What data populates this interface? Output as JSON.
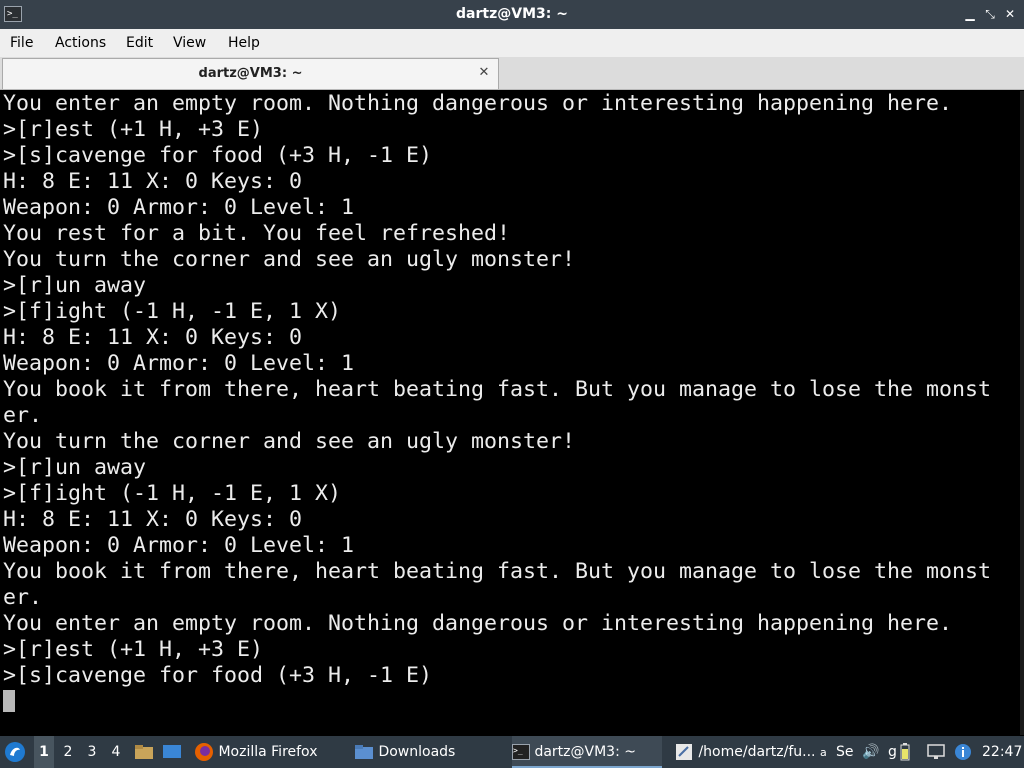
{
  "window": {
    "title": "dartz@VM3: ~",
    "buttons": {
      "minimize": "▁",
      "maximize": "⤡",
      "close": "✕"
    }
  },
  "menu": [
    "File",
    "Actions",
    "Edit",
    "View",
    "Help"
  ],
  "tab": {
    "label": "dartz@VM3: ~",
    "close": "✕"
  },
  "terminal": {
    "lines": [
      "You enter an empty room. Nothing dangerous or interesting happening here.",
      ">[r]est (+1 H, +3 E)",
      ">[s]cavenge for food (+3 H, -1 E)",
      "H: 8 E: 11 X: 0 Keys: 0",
      "Weapon: 0 Armor: 0 Level: 1",
      "You rest for a bit. You feel refreshed!",
      "You turn the corner and see an ugly monster!",
      ">[r]un away",
      ">[f]ight (-1 H, -1 E, 1 X)",
      "H: 8 E: 11 X: 0 Keys: 0",
      "Weapon: 0 Armor: 0 Level: 1",
      "You book it from there, heart beating fast. But you manage to lose the monst",
      "er.",
      "You turn the corner and see an ugly monster!",
      ">[r]un away",
      ">[f]ight (-1 H, -1 E, 1 X)",
      "H: 8 E: 11 X: 0 Keys: 0",
      "Weapon: 0 Armor: 0 Level: 1",
      "You book it from there, heart beating fast. But you manage to lose the monst",
      "er.",
      "You enter an empty room. Nothing dangerous or interesting happening here.",
      ">[r]est (+1 H, +3 E)",
      ">[s]cavenge for food (+3 H, -1 E)"
    ]
  },
  "taskbar": {
    "workspaces": [
      "1",
      "2",
      "3",
      "4"
    ],
    "tasks": {
      "firefox": "Mozilla Firefox",
      "downloads": "Downloads",
      "terminal": "dartz@VM3: ~",
      "editor": "/home/dartz/fu...",
      "editor_extra": "a",
      "se": "Se",
      "g": "g"
    },
    "clock": "22:47"
  },
  "colors": {
    "titlebar": "#37414b",
    "terminal_bg": "#000000",
    "terminal_fg": "#ececec",
    "taskbar": "#2f3a44",
    "menubar": "#efefef"
  }
}
